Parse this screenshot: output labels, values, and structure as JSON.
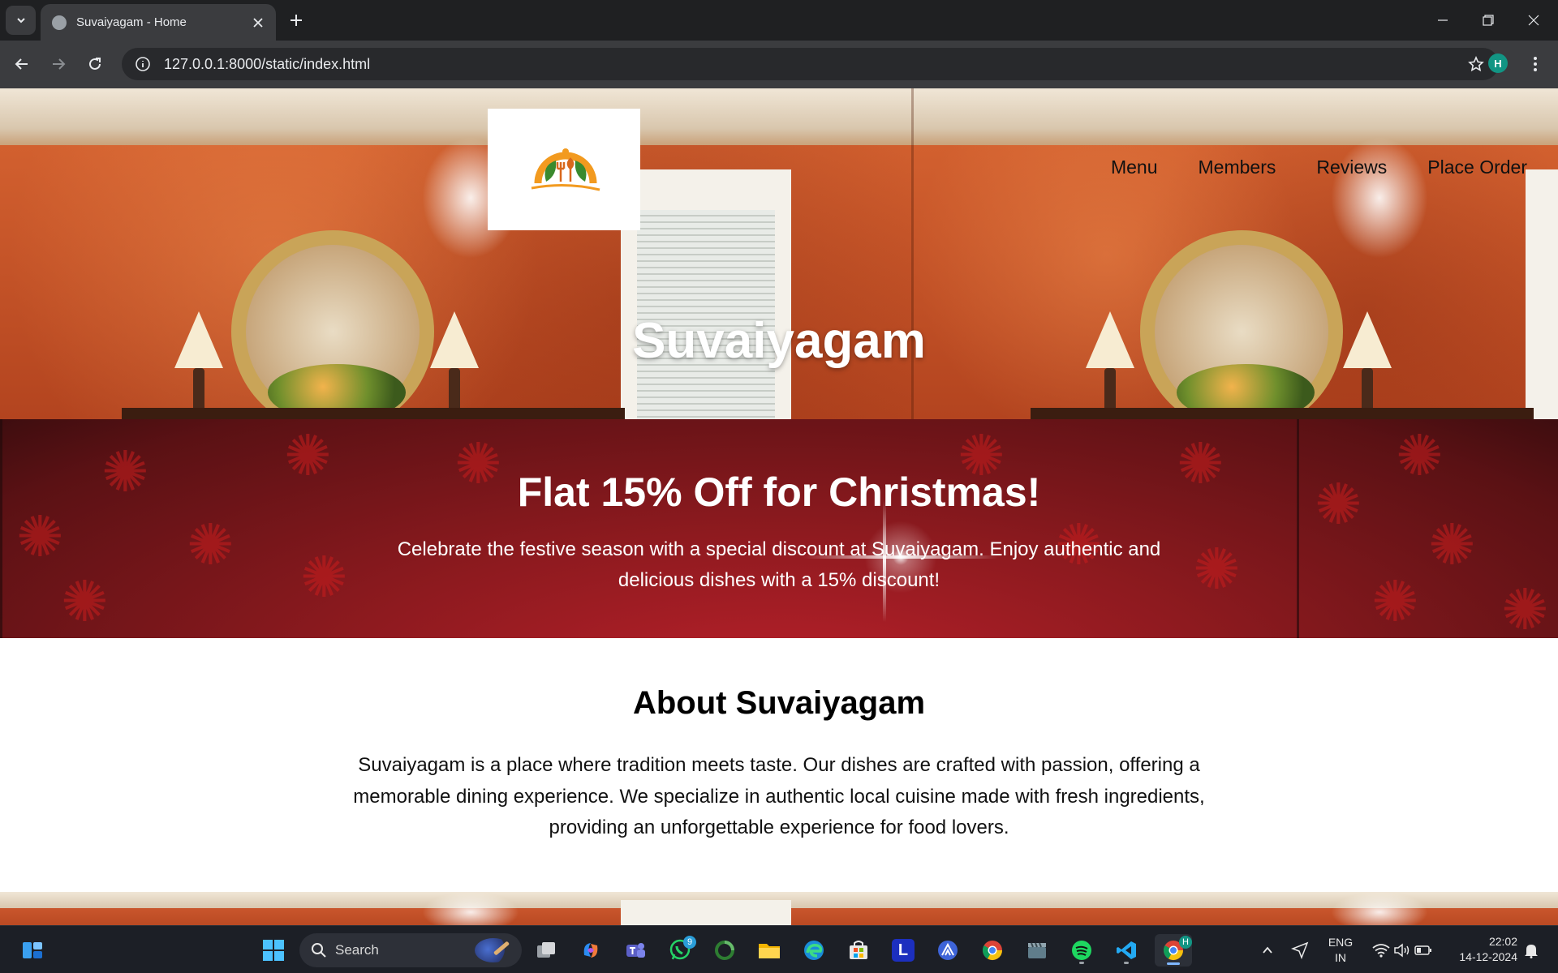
{
  "browser": {
    "tab_title": "Suvaiyagam - Home",
    "url": "127.0.0.1:8000/static/index.html",
    "profile_initial": "H"
  },
  "site": {
    "nav": [
      "Menu",
      "Members",
      "Reviews",
      "Place Order"
    ],
    "hero_title": "Suvaiyagam",
    "promo_title": "Flat 15% Off for Christmas!",
    "promo_text": "Celebrate the festive season with a special discount at Suvaiyagam. Enjoy authentic and delicious dishes with a 15% discount!",
    "about_title": "About Suvaiyagam",
    "about_text": "Suvaiyagam is a place where tradition meets taste. Our dishes are crafted with passion, offering a memorable dining experience. We specialize in authentic local cuisine made with fresh ingredients, providing an unforgettable experience for food lovers."
  },
  "taskbar": {
    "search_placeholder": "Search",
    "whatsapp_badge": "9",
    "chrome_badge": "H",
    "lang_line1": "ENG",
    "lang_line2": "IN",
    "time": "22:02",
    "date": "14-12-2024"
  },
  "colors": {
    "promo_red": "#8e1a1f",
    "logo_orange": "#f29a1f",
    "logo_green": "#3a8a2e"
  }
}
